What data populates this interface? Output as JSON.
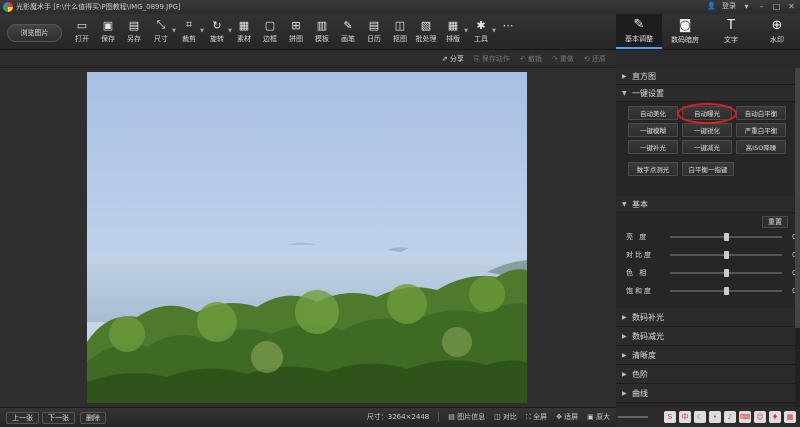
{
  "window": {
    "title": "光影魔术手 [F:\\什么值得买\\P图教程\\IMG_0899.JPG]",
    "login": "登录"
  },
  "toolbar": {
    "browse": "浏览图片",
    "tools": [
      {
        "label": "打开",
        "icon": "folder-icon"
      },
      {
        "label": "保存",
        "icon": "save-icon"
      },
      {
        "label": "另存",
        "icon": "save-as-icon"
      },
      {
        "label": "尺寸",
        "icon": "resize-icon"
      },
      {
        "label": "裁剪",
        "icon": "crop-icon"
      },
      {
        "label": "旋转",
        "icon": "rotate-icon"
      },
      {
        "label": "素材",
        "icon": "material-icon"
      },
      {
        "label": "边框",
        "icon": "frame-icon"
      },
      {
        "label": "拼图",
        "icon": "collage-icon"
      },
      {
        "label": "模板",
        "icon": "template-icon"
      },
      {
        "label": "画笔",
        "icon": "brush-icon"
      },
      {
        "label": "日历",
        "icon": "calendar-icon"
      },
      {
        "label": "抠图",
        "icon": "cutout-icon"
      },
      {
        "label": "批处理",
        "icon": "batch-icon"
      },
      {
        "label": "排版",
        "icon": "layout-icon"
      },
      {
        "label": "工具",
        "icon": "wrench-icon"
      }
    ]
  },
  "right_tabs": [
    {
      "label": "基本调整",
      "icon": "edit-icon"
    },
    {
      "label": "数码暗房",
      "icon": "camera-icon"
    },
    {
      "label": "文字",
      "icon": "text-icon"
    },
    {
      "label": "水印",
      "icon": "watermark-icon"
    }
  ],
  "subbar": {
    "share": "分享",
    "save_action": "保存动作",
    "undo": "撤销",
    "redo": "重做",
    "restore": "还原"
  },
  "panel": {
    "histogram": "直方图",
    "oneclick": "一键设置",
    "buttons": [
      "自动美化",
      "自动曝光",
      "自动白平衡",
      "一键模糊",
      "一键锐化",
      "严重白平衡",
      "一键补光",
      "一键减光",
      "高ISO降噪"
    ],
    "buttons2": [
      "数字点测光",
      "白平衡一指键"
    ],
    "basic": "基本",
    "reset": "重置",
    "sliders": [
      {
        "label": "亮 度",
        "value": "0",
        "pos": 0.5
      },
      {
        "label": "对比度",
        "value": "0",
        "pos": 0.5
      },
      {
        "label": "色 相",
        "value": "0",
        "pos": 0.5
      },
      {
        "label": "饱和度",
        "value": "0",
        "pos": 0.5
      }
    ],
    "collapsed": [
      "数码补光",
      "数码减光",
      "清晰度",
      "色阶",
      "曲线"
    ]
  },
  "bottom": {
    "prev": "上一张",
    "next": "下一张",
    "delete": "删除",
    "size": "尺寸：3264×2448",
    "info": "图片信息",
    "compare": "对比",
    "fullscreen": "全屏",
    "fit": "适屏",
    "zoom": "原大"
  }
}
